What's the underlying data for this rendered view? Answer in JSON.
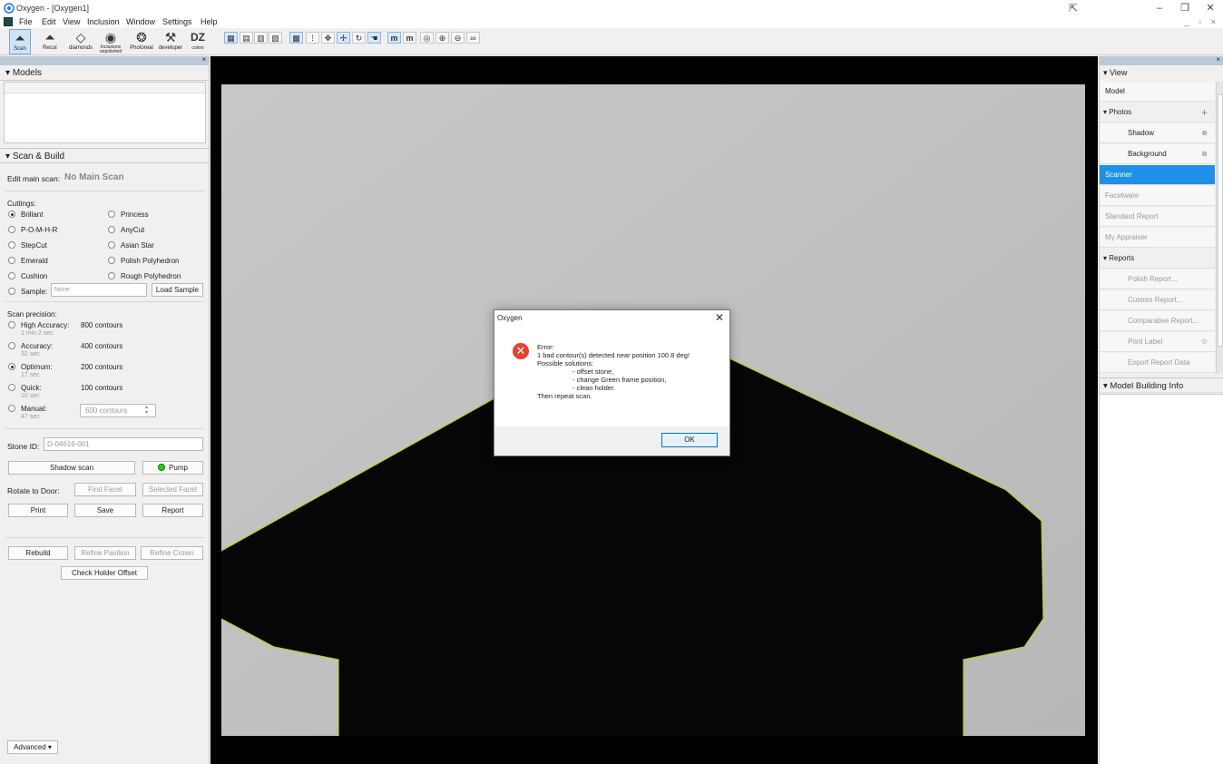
{
  "window": {
    "title": "Oxygen - [Oxygen1]",
    "minimize": "–",
    "restore": "❐",
    "close": "✕",
    "mdi_controls": "_ ▫ ×"
  },
  "menu": [
    "File",
    "Edit",
    "View",
    "Inclusion",
    "Window",
    "Settings",
    "Help"
  ],
  "toolbar": {
    "buttons": [
      {
        "label": "Scan",
        "icon": "scan-icon"
      },
      {
        "label": "Recut",
        "icon": "recut-icon"
      },
      {
        "label": "diamonds",
        "icon": "diamond-icon"
      },
      {
        "label": "Inclusions\nunpolished",
        "icon": "eye-icon"
      },
      {
        "label": "Photoreal",
        "icon": "photoreal-icon"
      },
      {
        "label": "developer",
        "icon": "tools-icon"
      },
      {
        "label": "DZ\ncolors",
        "icon": "dz-icon"
      }
    ]
  },
  "left": {
    "models_header": "Models",
    "scan_header": "Scan & Build",
    "edit_main_scan_label": "Edit main scan:",
    "edit_main_scan_value": "No Main Scan",
    "cuttings_label": "Cuttings:",
    "cuttings": [
      {
        "label": "Brillant",
        "checked": true
      },
      {
        "label": "Princess",
        "checked": false
      },
      {
        "label": "P-O-M-H-R",
        "checked": false
      },
      {
        "label": "AnyCut",
        "checked": false
      },
      {
        "label": "StepCut",
        "checked": false
      },
      {
        "label": "Asian Star",
        "checked": false
      },
      {
        "label": "Emerald",
        "checked": false
      },
      {
        "label": "Polish Polyhedron",
        "checked": false
      },
      {
        "label": "Cushion",
        "checked": false
      },
      {
        "label": "Rough Polyhedron",
        "checked": false
      }
    ],
    "sample_label": "Sample:",
    "sample_placeholder": "None",
    "load_sample": "Load Sample",
    "scan_precision_label": "Scan precision:",
    "precision": [
      {
        "label": "High Accuracy:",
        "time": "1 min 2 sec",
        "contours": "800 contours",
        "checked": false
      },
      {
        "label": "Accuracy:",
        "time": "32 sec",
        "contours": "400 contours",
        "checked": false
      },
      {
        "label": "Optimum:",
        "time": "17 sec",
        "contours": "200 contours",
        "checked": true
      },
      {
        "label": "Quick:",
        "time": "10 sec",
        "contours": "100 contours",
        "checked": false
      },
      {
        "label": "Manual:",
        "time": "47 sec",
        "contours": "600 contours",
        "checked": false
      }
    ],
    "stone_id_label": "Stone ID:",
    "stone_id_value": "D-04616-001",
    "shadow_scan": "Shadow scan",
    "pump": "Pump",
    "rotate_to_door": "Rotate to Door:",
    "first_facet": "First Facet",
    "selected_facet": "Selected Facet",
    "print": "Print",
    "save": "Save",
    "report": "Report",
    "rebuild": "Rebuild",
    "refine_pavilion": "Refine Pavilion",
    "refine_crown": "Refine Crown",
    "check_holder_offset": "Check Holder Offset",
    "advanced": "Advanced"
  },
  "dialog": {
    "title": "Oxygen",
    "close": "✕",
    "lines": [
      "Error:",
      " 1 bad contour(s) detected near position 100.8 deg!",
      "Possible solutions:",
      "- offset stone,",
      "- change Green frame position,",
      "- clean holder.",
      "Then repeat scan."
    ],
    "ok": "OK"
  },
  "right": {
    "view_header": "View",
    "model": "Model",
    "photos": "Photos",
    "shadow": "Shadow",
    "background": "Background",
    "scanner": "Scanner",
    "facetware": "Facetware",
    "standard_report": "Standard Report",
    "my_appraiser": "My Appraiser",
    "reports": "Reports",
    "polish_report": "Polish Report...",
    "custom_report": "Custom Report...",
    "comparative_report": "Comparative Report...",
    "print_label": "Print Label",
    "export_report_data": "Export Report Data",
    "model_building_info": "Model Building Info"
  },
  "colors": {
    "selection": "#1e90e8",
    "contour": "#c8c81e",
    "pump_led": "#22cc22",
    "error": "#e8412c"
  }
}
